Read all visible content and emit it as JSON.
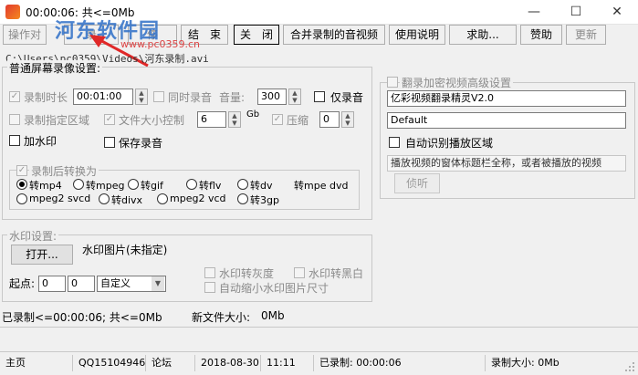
{
  "window": {
    "title": "00:00:06: 共<=0Mb",
    "minimize": "—",
    "maximize": "☐",
    "close": "✕"
  },
  "watermark": {
    "text": "河东软件园",
    "url": "www.pc0359.cn"
  },
  "toolbar": {
    "buttons": [
      {
        "label": "操作对",
        "state": "disabled"
      },
      {
        "label": "录",
        "state": "disabled"
      },
      {
        "label": "停",
        "state": "disabled"
      },
      {
        "label": "结　束",
        "state": "normal"
      },
      {
        "label": "关　闭",
        "state": "pressed"
      },
      {
        "label": "合并录制的音视频",
        "state": "normal"
      },
      {
        "label": "使用说明",
        "state": "normal"
      },
      {
        "label": "求助...",
        "state": "normal"
      },
      {
        "label": "赞助",
        "state": "normal"
      },
      {
        "label": "更新",
        "state": "disabled"
      }
    ]
  },
  "path": "C:\\Users\\pc0359\\Videos\\河东录制.avi",
  "screen_settings": {
    "title": "普通屏幕录像设置:",
    "rec_duration_label": "录制时长",
    "rec_duration_value": "00:01:00",
    "sync_audio_label": "同时录音",
    "volume_label": "音量:",
    "volume_value": "300",
    "audio_only_label": "仅录音",
    "region_label": "录制指定区域",
    "filesize_label": "文件大小控制",
    "filesize_value": "6",
    "filesize_unit": "Gb",
    "compress_label": "压缩",
    "compress_value": "0",
    "watermark_label": "加水印",
    "save_audio_label": "保存录音"
  },
  "convert": {
    "title": "录制后转换为",
    "options": [
      "转mp4",
      "转mpeg",
      "转gif",
      "转flv",
      "转dv",
      "转mpe dvd",
      "mpeg2 svcd",
      "转divx",
      "mpeg2 vcd",
      "转3gp"
    ],
    "selected": "转mp4"
  },
  "watermark_settings": {
    "title": "水印设置:",
    "open_button": "打开...",
    "image_label": "水印图片(未指定)",
    "start_label": "起点:",
    "start_x": "0",
    "start_y": "0",
    "mode_value": "自定义",
    "grayscale_label": "水印转灰度",
    "bw_label": "水印转黑白",
    "auto_shrink_label": "自动缩小水印图片尺寸"
  },
  "encrypted": {
    "title": "翻录加密视频高级设置",
    "software_value": "亿彩视频翻录精灵V2.0",
    "mode_value": "Default",
    "auto_detect_label": "自动识别播放区域",
    "window_title_placeholder": "播放视频的窗体标题栏全称，或者被播放的视频",
    "sniff_button": "侦听"
  },
  "info": {
    "recorded_text": "已录制<=00:00:06; 共<=0Mb",
    "new_file_label": "新文件大小:",
    "new_file_value": "0Mb"
  },
  "status": {
    "home": "主页",
    "qq": "QQ15104946",
    "forum": "论坛",
    "date": "2018-08-30",
    "time": "11:11",
    "recorded": "已录制: 00:00:06",
    "recorded_size": "录制大小: 0Mb"
  },
  "colors": {
    "watermark_blue": "#2f6fc7",
    "arrow_red": "#e02828"
  }
}
